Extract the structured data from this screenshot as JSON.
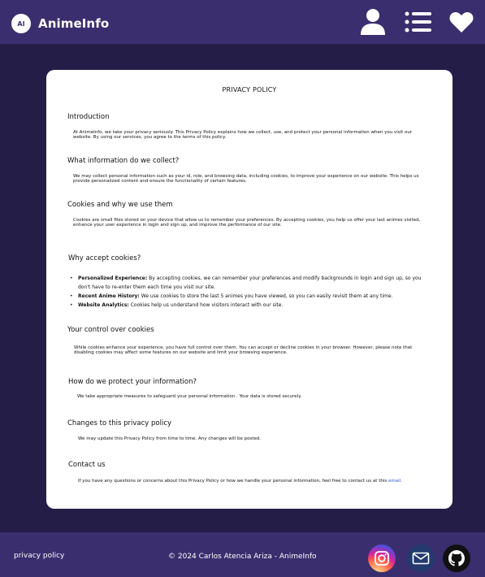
{
  "header": {
    "logo_text": "AI",
    "brand": "AnimeInfo",
    "icons": [
      "user-icon",
      "menu-icon",
      "heart-icon"
    ]
  },
  "policy": {
    "title": "PRIVACY POLICY",
    "intro": {
      "heading": "Introduction",
      "text": "At AnimeInfo, we take your privacy seriously. This Privacy Policy explains how we collect, use, and protect your personal information when you visit our website. By using our services, you agree to the terms of this policy."
    },
    "collect": {
      "heading": "What information do we collect?",
      "text": "We may collect personal information such as your id, role, and browsing data, including cookies, to improve your experience on our website. This helps us provide personalized content and ensure the functionality of certain features."
    },
    "cookies": {
      "heading": "Cookies and why we use them",
      "text": "Cookies are small files stored on your device that allow us to remember your preferences. By accepting cookies, you help us offer your last animes visited, enhance your user experience in login and sign up, and improve the performance of our site."
    },
    "accept": {
      "heading": "Why accept cookies?",
      "items": [
        {
          "label": "Personalized Experience:",
          "text": " By accepting cookies, we can remember your preferences and modify backgrounds in login and sign up, so you don't have to re-enter them each time you visit our site."
        },
        {
          "label": "Recent Anime History:",
          "text": " We use cookies to store the last 5 animes you have viewed, so you can easily revisit them at any time."
        },
        {
          "label": "Website Analytics:",
          "text": " Cookies help us understand how visitors interact with our site."
        }
      ]
    },
    "control": {
      "heading": "Your control over cookies",
      "text": "While cookies enhance your experience, you have full control over them. You can accept or decline cookies in your browser. However, please note that disabling cookies may affect some features on our website and limit your browsing experience."
    },
    "protect": {
      "heading": "How do we protect your information?",
      "text": "We take appropriate measures to safeguard your personal information . Your data is stored securely."
    },
    "changes": {
      "heading": "Changes to this privacy policy",
      "text": "We may update this Privacy Policy from time to time. Any changes will be posted."
    },
    "contact": {
      "heading": "Contact us",
      "text": "If you have any questions or concerns about this Privacy Policy or how we handle your personal information, feel free to contact us at this ",
      "link": "email."
    }
  },
  "footer": {
    "privacy_link": "privacy policy",
    "copyright": "© 2024 Carlos Atencia Ariza - AnimeInfo",
    "icons": [
      "instagram-icon",
      "email-icon",
      "github-icon"
    ]
  }
}
